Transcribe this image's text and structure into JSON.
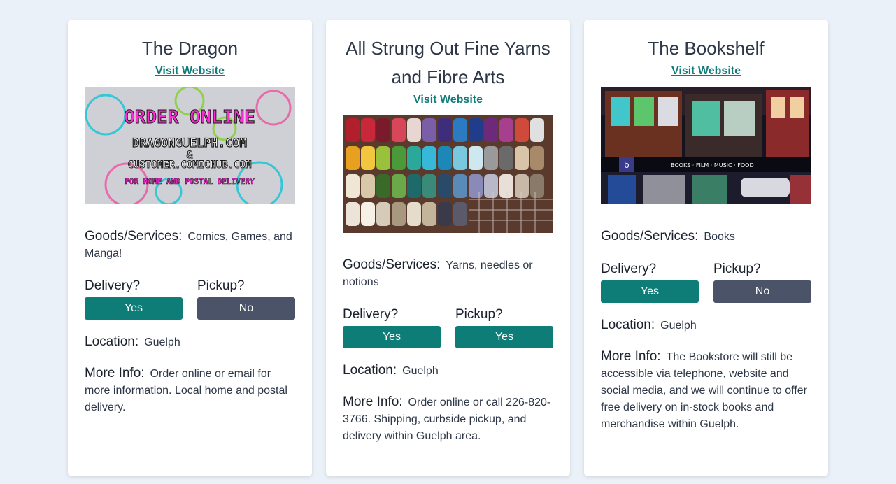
{
  "cards": [
    {
      "title": "The Dragon",
      "link_text": "Visit Website",
      "image_text": {
        "line1": "ORDER ONLINE",
        "line2": "DRAGONGUELPH.COM",
        "line3": "&",
        "line4": "CUSTOMER.COMICHUB.COM",
        "line5": "FOR HOME AND POSTAL DELIVERY"
      },
      "goods_label": "Goods/Services:",
      "goods_value": "Comics, Games, and Manga!",
      "delivery_label": "Delivery?",
      "delivery_value": "Yes",
      "pickup_label": "Pickup?",
      "pickup_value": "No",
      "location_label": "Location:",
      "location_value": "Guelph",
      "info_label": "More Info:",
      "info_value": "Order online or email for more information. Local home and postal delivery."
    },
    {
      "title": "All Strung Out Fine Yarns and Fibre Arts",
      "link_text": "Visit Website",
      "goods_label": "Goods/Services:",
      "goods_value": "Yarns, needles or notions",
      "delivery_label": "Delivery?",
      "delivery_value": "Yes",
      "pickup_label": "Pickup?",
      "pickup_value": "Yes",
      "location_label": "Location:",
      "location_value": "Guelph",
      "info_label": "More Info:",
      "info_value": "Order online or call 226-820-3766. Shipping, curbside pickup, and delivery within Guelph area."
    },
    {
      "title": "The Bookshelf",
      "link_text": "Visit Website",
      "image_text": {
        "sign": "BOOKS · FILM · MUSIC · FOOD"
      },
      "goods_label": "Goods/Services:",
      "goods_value": "Books",
      "delivery_label": "Delivery?",
      "delivery_value": "Yes",
      "pickup_label": "Pickup?",
      "pickup_value": "No",
      "location_label": "Location:",
      "location_value": "Guelph",
      "info_label": "More Info:",
      "info_value": "The Bookstore will still be accessible via telephone, website and social media, and we will continue to offer free delivery on in-stock books and merchandise within Guelph."
    }
  ],
  "colors": {
    "page_bg": "#ebf1f8",
    "link": "#117a7a",
    "yes_button": "#0e7c77",
    "no_button": "#4a5368"
  }
}
